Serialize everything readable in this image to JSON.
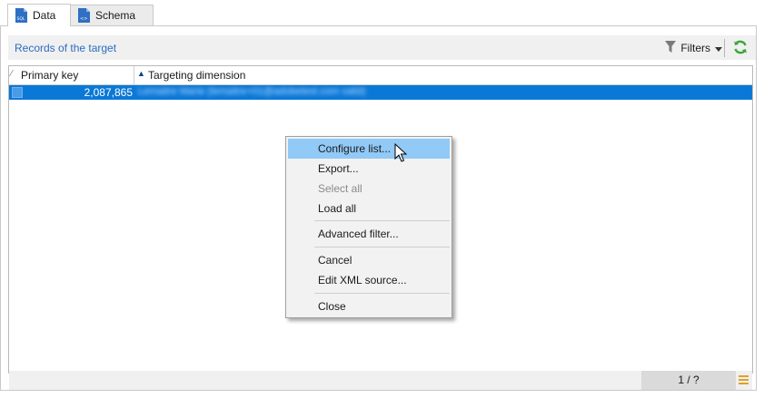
{
  "tabs": [
    {
      "label": "Data",
      "icon": "sql-file-icon",
      "active": true
    },
    {
      "label": "Schema",
      "icon": "schema-file-icon",
      "active": false
    }
  ],
  "header": {
    "title": "Records of the target",
    "filters_label": "Filters"
  },
  "grid": {
    "columns": [
      {
        "label": "Primary key",
        "sort": "none"
      },
      {
        "label": "Targeting dimension",
        "sort": "ascending"
      }
    ],
    "rows": [
      {
        "primary_key": "2,087,865",
        "targeting_dimension": "Lemaitre Marie (lemaitre+01@adobetest.com valid)",
        "selected": true
      }
    ]
  },
  "footer": {
    "pager": "1 / ?"
  },
  "context_menu": {
    "items": [
      {
        "label": "Configure list...",
        "highlighted": true,
        "disabled": false
      },
      {
        "label": "Export...",
        "highlighted": false,
        "disabled": false
      },
      {
        "label": "Select all",
        "highlighted": false,
        "disabled": true
      },
      {
        "label": "Load all",
        "highlighted": false,
        "disabled": false
      },
      {
        "label": "Advanced filter...",
        "highlighted": false,
        "disabled": false
      },
      {
        "label": "Cancel",
        "highlighted": false,
        "disabled": false
      },
      {
        "label": "Edit XML source...",
        "highlighted": false,
        "disabled": false
      },
      {
        "label": "Close",
        "highlighted": false,
        "disabled": false
      }
    ]
  },
  "colors": {
    "accent_blue": "#2b6dbf",
    "selection": "#0a78d7",
    "menu_highlight": "#91c9f7",
    "refresh_green": "#3aa63a"
  }
}
